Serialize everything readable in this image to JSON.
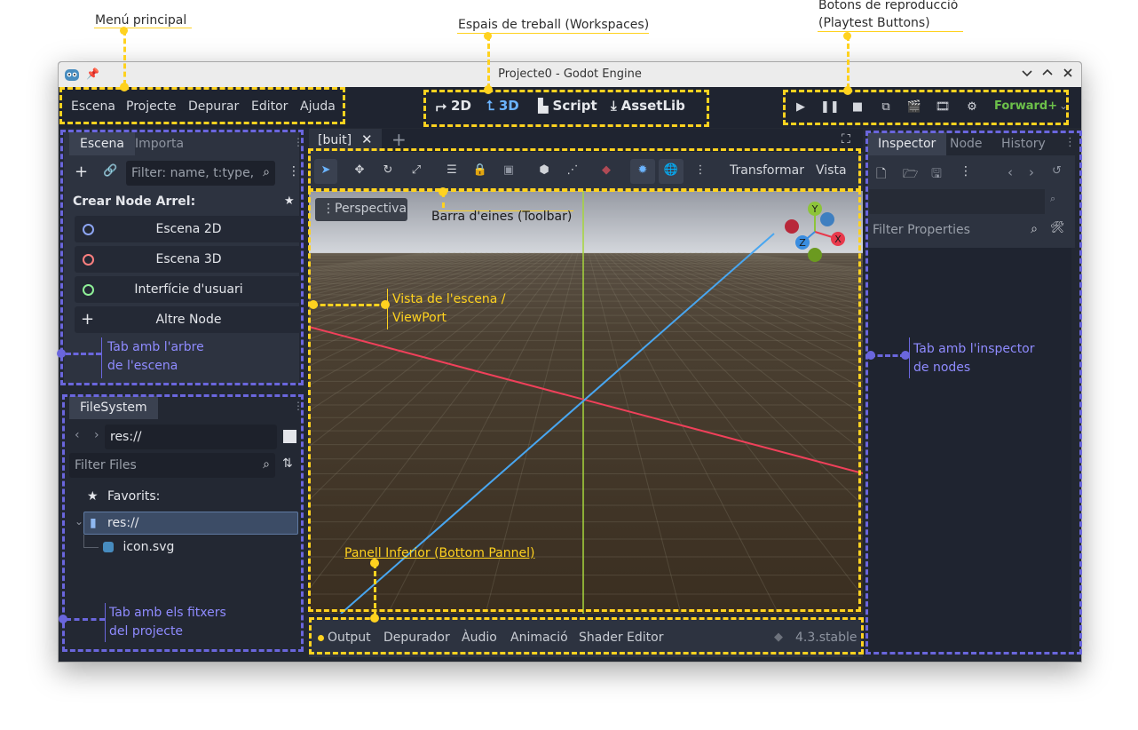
{
  "window": {
    "title": "Projecte0 - Godot Engine"
  },
  "menu": [
    "Escena",
    "Projecte",
    "Depurar",
    "Editor",
    "Ajuda"
  ],
  "workspaces": [
    {
      "label": "2D",
      "icon": "2d-icon"
    },
    {
      "label": "3D",
      "icon": "3d-icon",
      "active": true
    },
    {
      "label": "Script",
      "icon": "script-icon"
    },
    {
      "label": "AssetLib",
      "icon": "download-icon"
    }
  ],
  "renderer": "Forward+",
  "scene_dock": {
    "tabs": [
      "Escena",
      "Importa"
    ],
    "filter_placeholder": "Filter: name, t:type,",
    "create_root_label": "Crear Node Arrel:",
    "node_buttons": [
      {
        "label": "Escena 2D",
        "color": "#8da5f3"
      },
      {
        "label": "Escena 3D",
        "color": "#fc7f7f"
      },
      {
        "label": "Interfície d'usuari",
        "color": "#8eef97"
      },
      {
        "label": "Altre Node",
        "color": "#e4e6eb"
      }
    ]
  },
  "filesystem": {
    "tab": "FileSystem",
    "path": "res://",
    "filter_placeholder": "Filter Files",
    "favorites_label": "Favorits:",
    "items": [
      {
        "label": "res://",
        "type": "folder",
        "selected": true
      },
      {
        "label": "icon.svg",
        "type": "file"
      }
    ]
  },
  "viewport": {
    "tab": "[buit]",
    "perspective_label": "Perspectiva",
    "toolbar_menus": [
      "Transformar",
      "Vista"
    ],
    "gizmo": {
      "x": "X",
      "y": "Y",
      "z": "Z"
    }
  },
  "bottom_panel": {
    "tabs": [
      "Output",
      "Depurador",
      "Àudio",
      "Animació",
      "Shader Editor"
    ],
    "version": "4.3.stable"
  },
  "inspector": {
    "tabs": [
      "Inspector",
      "Node",
      "History"
    ],
    "filter_placeholder": "Filter Properties"
  },
  "annotations": {
    "main_menu": "Menú principal",
    "workspaces": "Espais de treball (Workspaces)",
    "playtest_1": "Botons de reproducció",
    "playtest_2": "(Playtest Buttons)",
    "toolbar": "Barra d'eines (Toolbar)",
    "viewport_1": "Vista de l'escena /",
    "viewport_2": "ViewPort",
    "bottom_panel": "Panell Inferior (Bottom Pannel)",
    "scene_tree_1": "Tab amb l'arbre",
    "scene_tree_2": "de l'escena",
    "files_1": "Tab amb els fitxers",
    "files_2": "del projecte",
    "inspector_1": "Tab amb l'inspector",
    "inspector_2": "de nodes"
  },
  "colors": {
    "accent": "#6bb4ff",
    "annotation_yellow": "#ffd21f",
    "annotation_blue": "#6a66dd",
    "renderer": "#6cc04a"
  }
}
